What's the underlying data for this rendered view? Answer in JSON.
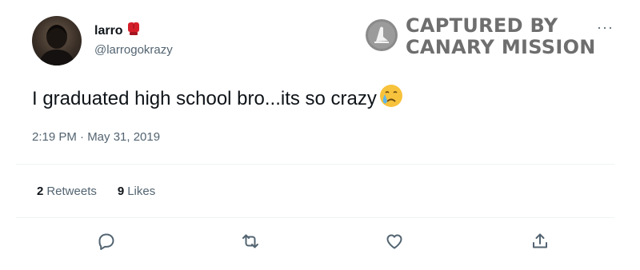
{
  "user": {
    "display_name": "larro",
    "handle": "@larrogokrazy",
    "name_emoji": "boxing-glove-icon"
  },
  "watermark": {
    "line1": "CAPTURED BY",
    "line2": "CANARY MISSION"
  },
  "more_label": "···",
  "tweet": {
    "text": "I graduated high school bro...its so crazy",
    "emoji": "crying-face-icon",
    "timestamp": "2:19 PM · May 31, 2019"
  },
  "stats": {
    "retweets_count": "2",
    "retweets_label": "Retweets",
    "likes_count": "9",
    "likes_label": "Likes"
  },
  "actions": [
    "reply-icon",
    "retweet-icon",
    "like-icon",
    "share-icon"
  ],
  "colors": {
    "text": "#0f1419",
    "secondary": "#536471",
    "divider": "#eff3f4",
    "watermark": "#6e6e6e"
  }
}
